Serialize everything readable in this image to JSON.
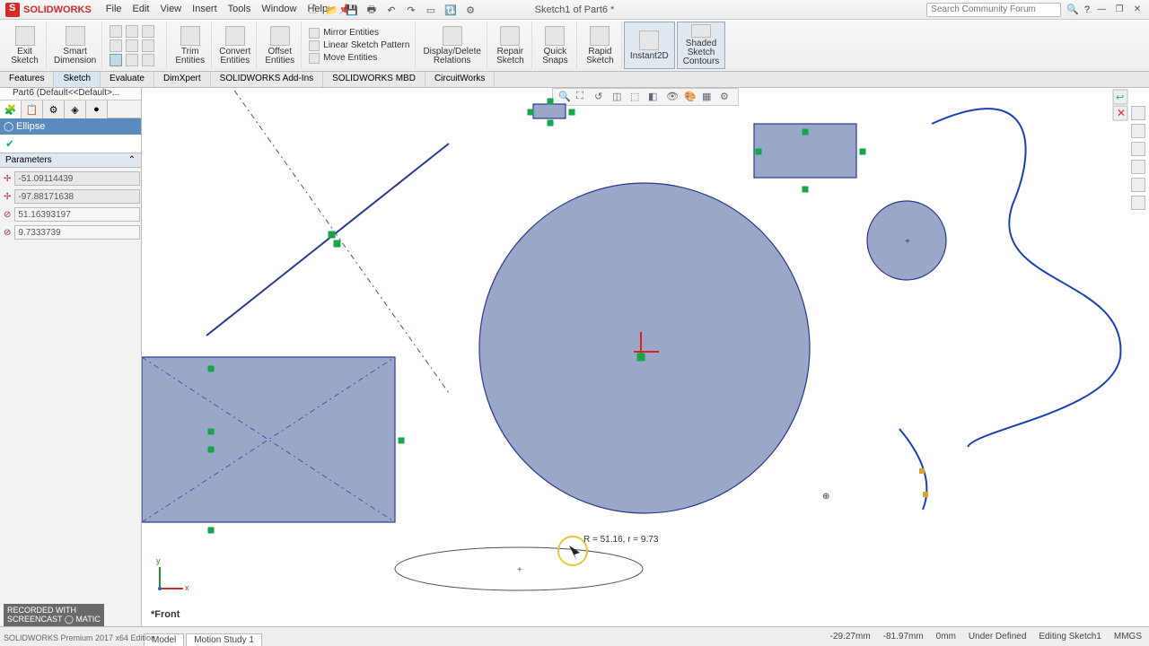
{
  "app": {
    "name": "SOLIDWORKS",
    "doc_title": "Sketch1 of Part6 *",
    "search_placeholder": "Search Community Forum"
  },
  "menus": [
    "File",
    "Edit",
    "View",
    "Insert",
    "Tools",
    "Window",
    "Help"
  ],
  "ribbon": {
    "exit_sketch": "Exit\nSketch",
    "smart_dim": "Smart\nDimension",
    "trim": "Trim\nEntities",
    "convert": "Convert\nEntities",
    "offset": "Offset\nEntities",
    "mirror": "Mirror Entities",
    "linear": "Linear Sketch Pattern",
    "move": "Move Entities",
    "display": "Display/Delete\nRelations",
    "repair": "Repair\nSketch",
    "quick": "Quick\nSnaps",
    "rapid": "Rapid\nSketch",
    "instant": "Instant2D",
    "shaded": "Shaded\nSketch\nContours"
  },
  "ftabs": [
    "Features",
    "Sketch",
    "Evaluate",
    "DimXpert",
    "SOLIDWORKS Add-Ins",
    "SOLIDWORKS MBD",
    "CircuitWorks"
  ],
  "tree_head": "Part6 (Default<<Default>...",
  "pm": {
    "title": "Ellipse",
    "section": "Parameters",
    "p1": "-51.09114439",
    "p2": "-97.88171638",
    "p3": "51.16393197",
    "p4": "9.7333739"
  },
  "tooltip": "R = 51.16, r = 9.73",
  "triad": "*Front",
  "status": {
    "tab1": "Model",
    "tab2": "Motion Study 1",
    "x": "-29.27mm",
    "y": "-81.97mm",
    "z": "0mm",
    "def": "Under Defined",
    "mode": "Editing Sketch1",
    "units": "MMGS"
  },
  "edition": "SOLIDWORKS Premium 2017 x64 Edition",
  "recorded": "RECORDED WITH\nSCREENCAST ◯ MATIC"
}
